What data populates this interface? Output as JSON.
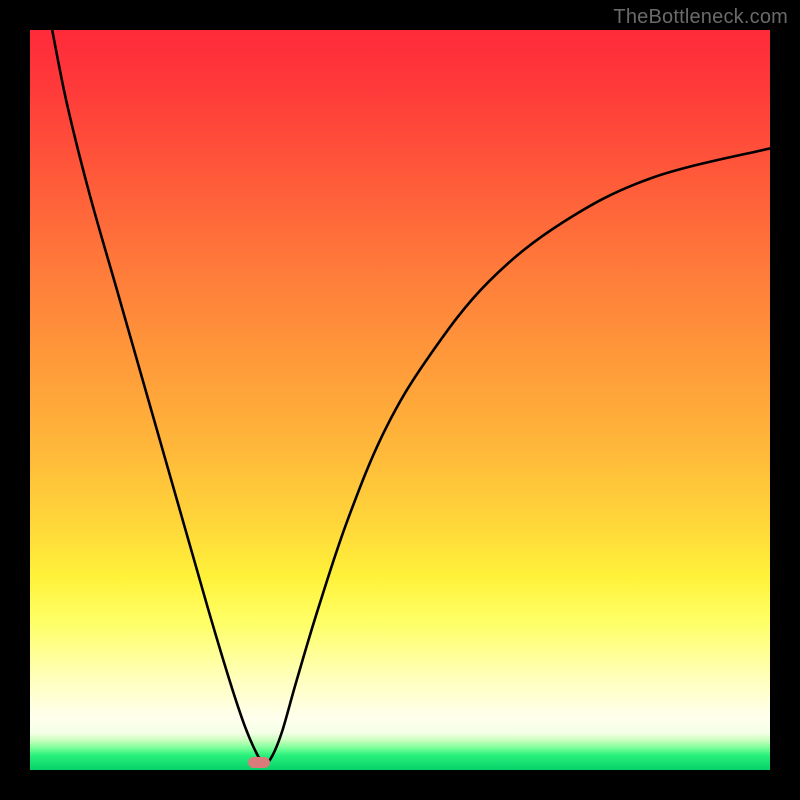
{
  "watermark": {
    "text": "TheBottleneck.com"
  },
  "colors": {
    "frame": "#000000",
    "curve_stroke": "#000000",
    "marker_fill": "#d97b7a",
    "gradient_top": "#ff2a3a",
    "gradient_bottom": "#06d26a"
  },
  "chart_data": {
    "type": "line",
    "title": "",
    "xlabel": "",
    "ylabel": "",
    "xlim": [
      0,
      100
    ],
    "ylim": [
      0,
      100
    ],
    "grid": false,
    "series": [
      {
        "name": "bottleneck-curve",
        "x": [
          3,
          5,
          8,
          12,
          16,
          20,
          24,
          27,
          29,
          30.5,
          31.5,
          32.5,
          34,
          36,
          39,
          43,
          48,
          54,
          62,
          72,
          84,
          100
        ],
        "y": [
          100,
          90,
          78,
          64,
          50,
          36,
          22,
          12,
          6,
          2.5,
          1,
          1.5,
          5,
          12,
          22,
          34,
          46,
          56,
          66,
          74,
          80,
          84
        ]
      }
    ],
    "annotations": [
      {
        "name": "minimum-marker",
        "x": 31,
        "y": 1,
        "shape": "pill"
      }
    ]
  }
}
